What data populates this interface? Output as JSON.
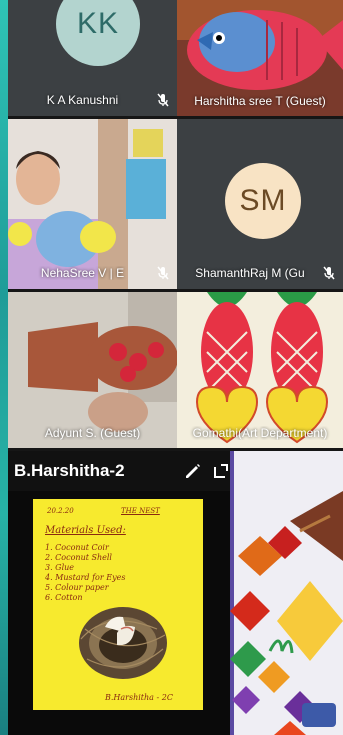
{
  "participants": [
    {
      "name": "K A Kanushni",
      "initials": "KK",
      "muted": true
    },
    {
      "name": "Harshitha sree T (Guest)",
      "muted": false
    },
    {
      "name": "NehaSree V | E",
      "muted": true
    },
    {
      "name": "ShamanthRaj M (Gu",
      "initials": "SM",
      "muted": true
    },
    {
      "name": "Adyunt S. (Guest)",
      "muted": false
    },
    {
      "name": "Gomathi(Art Department)",
      "muted": false
    }
  ],
  "presentation": {
    "title": "B.Harshitha-2",
    "edit_icon": "pencil-icon",
    "expand_icon": "expand-icon"
  },
  "worksheet": {
    "lines": [
      "20.2.20",
      "THE NEST",
      "Materials Used:",
      "1. Coconut Coir",
      "2. Coconut Shell",
      "3. Glue",
      "4. Mustard for Eyes",
      "5. Colour paper",
      "6. Cotton",
      "B.Harshitha - 2C"
    ]
  },
  "colors": {
    "teal": "#27b3a6",
    "tile_bg": "#3c4043",
    "kk_avatar": "#b3d4cf",
    "sm_avatar": "#f8e3c4",
    "paper_yellow": "#f7ea2e"
  }
}
